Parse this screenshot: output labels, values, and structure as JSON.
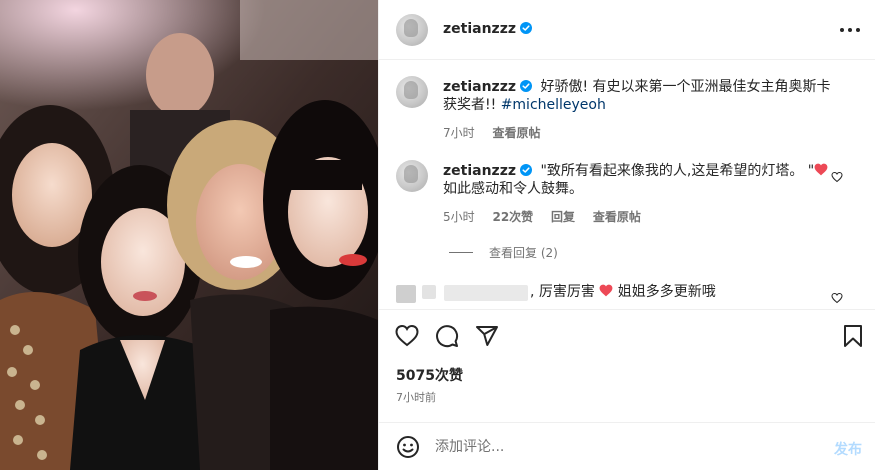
{
  "post": {
    "username": "zetianzzz",
    "verified_icon": "verified-badge-icon"
  },
  "caption": {
    "username": "zetianzzz",
    "text": "好骄傲! 有史以来第一个亚洲最佳女主角奥斯卡获奖者!! ",
    "hashtag": "#michelleyeoh",
    "time": "7小时",
    "translate": "查看原帖"
  },
  "comment1": {
    "username": "zetianzzz",
    "text_before": "\"致所有看起来像我的人,这是希望的灯塔。 \"",
    "text_after": "如此感动和令人鼓舞。",
    "time": "5小时",
    "likes": "22次赞",
    "reply": "回复",
    "translate": "查看原帖",
    "view_replies": "查看回复 (2)"
  },
  "comment2": {
    "text_before": ", 厉害厉害 ",
    "text_after": " 姐姐多多更新哦"
  },
  "likes_count": "5075次赞",
  "posted_ago": "7小时前",
  "composer": {
    "placeholder": "添加评论...",
    "post_label": "发布"
  },
  "colors": {
    "heart": "#ed4956",
    "link": "#00376b",
    "post_disabled": "#b3dbff",
    "muted": "#737373",
    "verified": "#0095f6"
  }
}
